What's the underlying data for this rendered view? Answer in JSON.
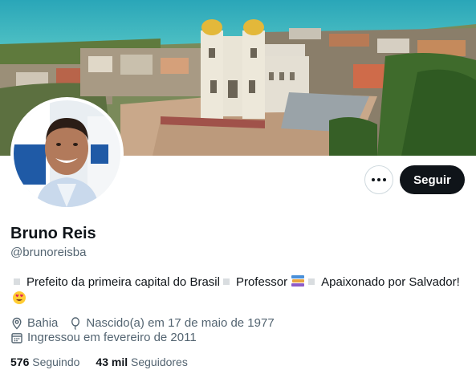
{
  "profile": {
    "name": "Bruno Reis",
    "handle": "@brunoreisba",
    "bio": {
      "part1": "Prefeito da primeira capital do Brasil",
      "part2": "Professor",
      "part3": "Apaixonado por Salvador!"
    },
    "location": "Bahia",
    "birth": "Nascido(a) em 17 de maio de 1977",
    "joined": "Ingressou em fevereiro de 2011"
  },
  "actions": {
    "follow_label": "Seguir",
    "more_icon": "more-horizontal-icon"
  },
  "stats": {
    "following_count": "576",
    "following_label": "Seguindo",
    "followers_count": "43 mil",
    "followers_label": "Seguidores"
  },
  "colors": {
    "text_primary": "#0f1419",
    "text_secondary": "#536471",
    "follow_bg": "#0f1419",
    "border": "#cfd9de"
  }
}
